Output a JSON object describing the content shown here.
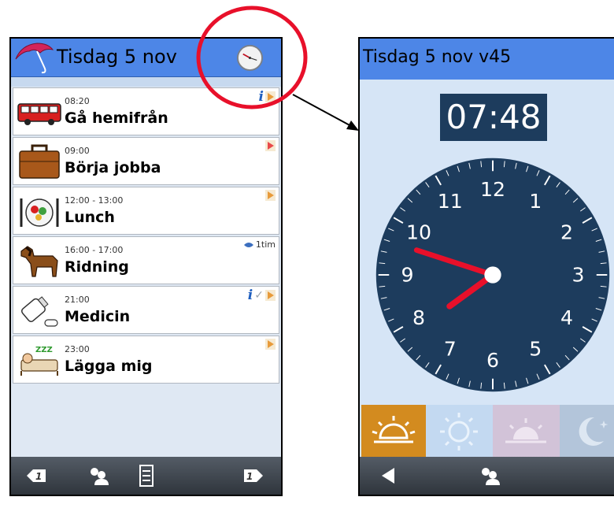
{
  "left_screen": {
    "title": "Tisdag 5 nov",
    "events": [
      {
        "time": "08:20",
        "name": "Gå hemifrån",
        "icon": "bus-icon",
        "markers": [
          "info",
          "flag"
        ]
      },
      {
        "time": "09:00",
        "name": "Börja jobba",
        "icon": "briefcase-icon",
        "markers": [
          "flag-alert"
        ]
      },
      {
        "time": "12:00 - 13:00",
        "name": "Lunch",
        "icon": "lunch-plate-icon",
        "markers": [
          "flag"
        ]
      },
      {
        "time": "16:00 - 17:00",
        "name": "Ridning",
        "icon": "horse-icon",
        "markers": [
          "duration"
        ],
        "duration": "1tim"
      },
      {
        "time": "21:00",
        "name": "Medicin",
        "icon": "medicine-bottle-icon",
        "markers": [
          "info",
          "check",
          "flag"
        ]
      },
      {
        "time": "23:00",
        "name": "Lägga mig",
        "icon": "sleeping-bed-icon",
        "markers": [
          "flag"
        ],
        "zzz": "ZZZ"
      }
    ],
    "bottom_buttons": [
      "previous-day-icon",
      "people-icon",
      "list-icon",
      "next-day-icon"
    ],
    "bottom_labels": {
      "prev": "1",
      "next": "1"
    }
  },
  "right_screen": {
    "title": "Tisdag 5 nov v45",
    "digital_time": "07:48",
    "clock_numbers": [
      "12",
      "1",
      "2",
      "3",
      "4",
      "5",
      "6",
      "7",
      "8",
      "9",
      "10",
      "11"
    ],
    "time": {
      "hour": 7,
      "minute": 48
    },
    "periods": [
      {
        "name": "sunrise-icon",
        "color": "#d38b1f",
        "active": true
      },
      {
        "name": "sun-icon",
        "color": "#c3d9f1",
        "active": false
      },
      {
        "name": "sunset-icon",
        "color": "#d2c3d8",
        "active": false
      },
      {
        "name": "moon-icon",
        "color": "#b3c5da",
        "active": false
      }
    ]
  },
  "colors": {
    "header_blue": "#4d86e7",
    "clock_face": "#1d3c5d",
    "hands": "#e8102a",
    "highlight_circle": "#e8102a"
  }
}
